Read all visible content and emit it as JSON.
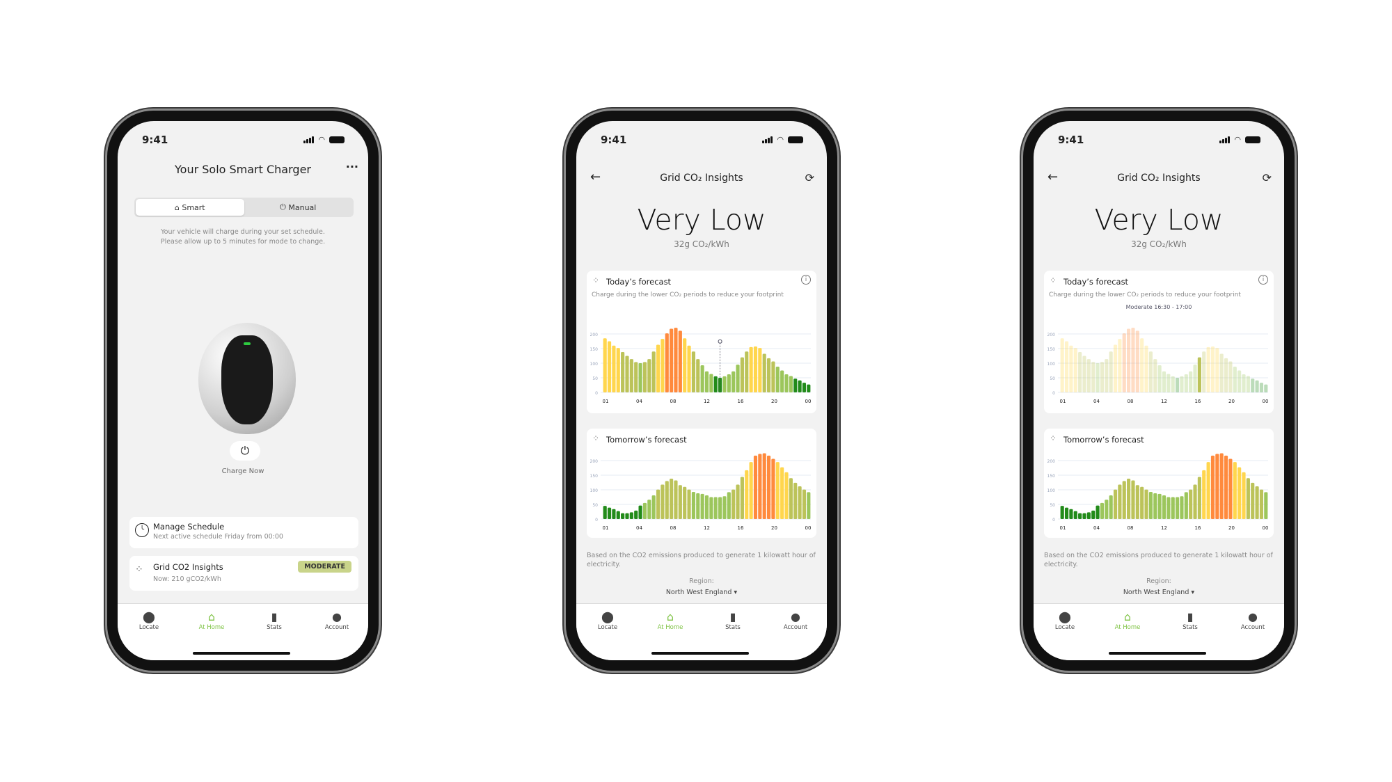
{
  "status_time": "9:41",
  "colors": {
    "very_low": "#228b1a",
    "low": "#9cc65c",
    "moderate": "#bcc35a",
    "high": "#ffd64d",
    "very_high": "#ff8a3d",
    "accent": "#7dc242"
  },
  "tabbar": {
    "items": [
      {
        "label": "Locate",
        "icon": "map-pin-icon"
      },
      {
        "label": "At Home",
        "icon": "home-icon",
        "active": true
      },
      {
        "label": "Stats",
        "icon": "bar-chart-icon"
      },
      {
        "label": "Account",
        "icon": "user-icon"
      }
    ]
  },
  "home": {
    "title": "Your Solo Smart Charger",
    "more_icon": "more-icon",
    "modes": [
      {
        "label": "Smart",
        "icon": "smart-home-icon",
        "active": true
      },
      {
        "label": "Manual",
        "icon": "plug-icon"
      }
    ],
    "help": [
      "Your vehicle will charge during your set schedule.",
      "Please allow up to 5 minutes for mode to change."
    ],
    "charge_now": "Charge Now",
    "schedule": {
      "title": "Manage Schedule",
      "subtitle": "Next active schedule Friday from 00:00"
    },
    "insights": {
      "title": "Grid CO2 Insights",
      "subtitle": "Now: 210 gCO2/kWh",
      "badge": "MODERATE"
    }
  },
  "insights": {
    "title": "Grid CO₂ Insights",
    "level": "Very Low",
    "intensity": "32g CO₂/kWh",
    "today_title": "Today’s forecast",
    "today_subtitle": "Charge during the lower CO₂ periods to reduce your footprint",
    "tomorrow_title": "Tomorrow’s forecast",
    "note": "Based on the CO2 emissions produced to generate 1 kilowatt hour of electricity.",
    "region_label": "Region:",
    "region": "North West England ▾",
    "tooltip": "Moderate 16:30 - 17:00"
  },
  "chart_data": [
    {
      "type": "bar",
      "title": "Today’s forecast",
      "ylim": [
        0,
        200
      ],
      "yticks": [
        "0",
        "50",
        "100",
        "150",
        "200"
      ],
      "xticks": [
        "01",
        "04",
        "08",
        "12",
        "16",
        "20",
        "00"
      ],
      "values": [
        185,
        175,
        160,
        152,
        138,
        125,
        114,
        104,
        100,
        104,
        114,
        140,
        163,
        183,
        202,
        218,
        221,
        211,
        185,
        160,
        140,
        114,
        93,
        72,
        63,
        55,
        50,
        55,
        62,
        72,
        95,
        120,
        140,
        155,
        157,
        152,
        132,
        117,
        106,
        88,
        75,
        62,
        56,
        47,
        41,
        33,
        27
      ],
      "current_index": 26,
      "selected_index": 31
    },
    {
      "type": "bar",
      "title": "Tomorrow’s forecast",
      "ylim": [
        0,
        200
      ],
      "yticks": [
        "0",
        "50",
        "100",
        "150",
        "200"
      ],
      "xticks": [
        "01",
        "04",
        "08",
        "12",
        "16",
        "20",
        "00"
      ],
      "values": [
        45,
        39,
        34,
        27,
        20,
        20,
        23,
        29,
        46,
        55,
        66,
        81,
        101,
        118,
        130,
        138,
        132,
        116,
        110,
        101,
        93,
        88,
        86,
        81,
        75,
        75,
        75,
        78,
        92,
        101,
        118,
        144,
        167,
        195,
        217,
        223,
        225,
        217,
        206,
        195,
        177,
        160,
        140,
        124,
        112,
        101,
        92
      ]
    }
  ]
}
